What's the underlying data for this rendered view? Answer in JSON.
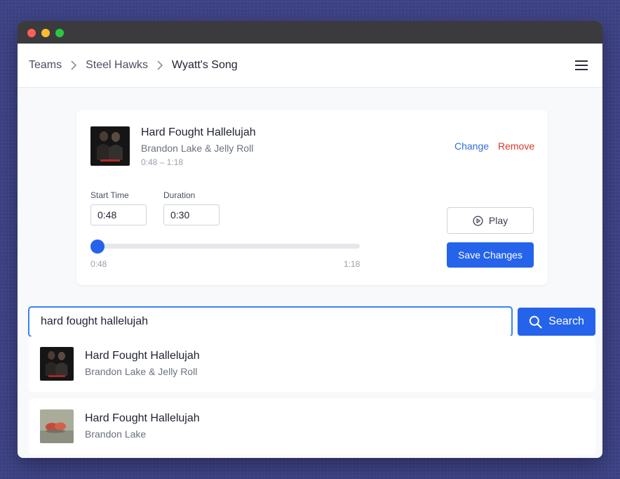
{
  "breadcrumb": {
    "items": [
      {
        "label": "Teams"
      },
      {
        "label": "Steel Hawks"
      },
      {
        "label": "Wyatt's Song"
      }
    ]
  },
  "selected_song": {
    "title": "Hard Fought Hallelujah",
    "artist": "Brandon Lake & Jelly Roll",
    "range": "0:48 – 1:18",
    "change_label": "Change",
    "remove_label": "Remove",
    "start_time_label": "Start Time",
    "start_time_value": "0:48",
    "duration_label": "Duration",
    "duration_value": "0:30",
    "slider_min": "0:48",
    "slider_max": "1:18",
    "slider_position": 0,
    "play_label": "Play",
    "save_label": "Save Changes"
  },
  "search": {
    "value": "hard fought hallelujah",
    "button_label": "Search"
  },
  "results": [
    {
      "title": "Hard Fought Hallelujah",
      "artist": "Brandon Lake & Jelly Roll"
    },
    {
      "title": "Hard Fought Hallelujah",
      "artist": "Brandon Lake"
    }
  ],
  "icons": {
    "menu": "hamburger-menu-icon",
    "separator": "chevron-right-icon",
    "play": "play-circle-icon",
    "search": "search-icon"
  },
  "colors": {
    "accent": "#2563eb",
    "link": "#2f6fdb",
    "danger": "#d9372b",
    "background": "#3d4285"
  }
}
